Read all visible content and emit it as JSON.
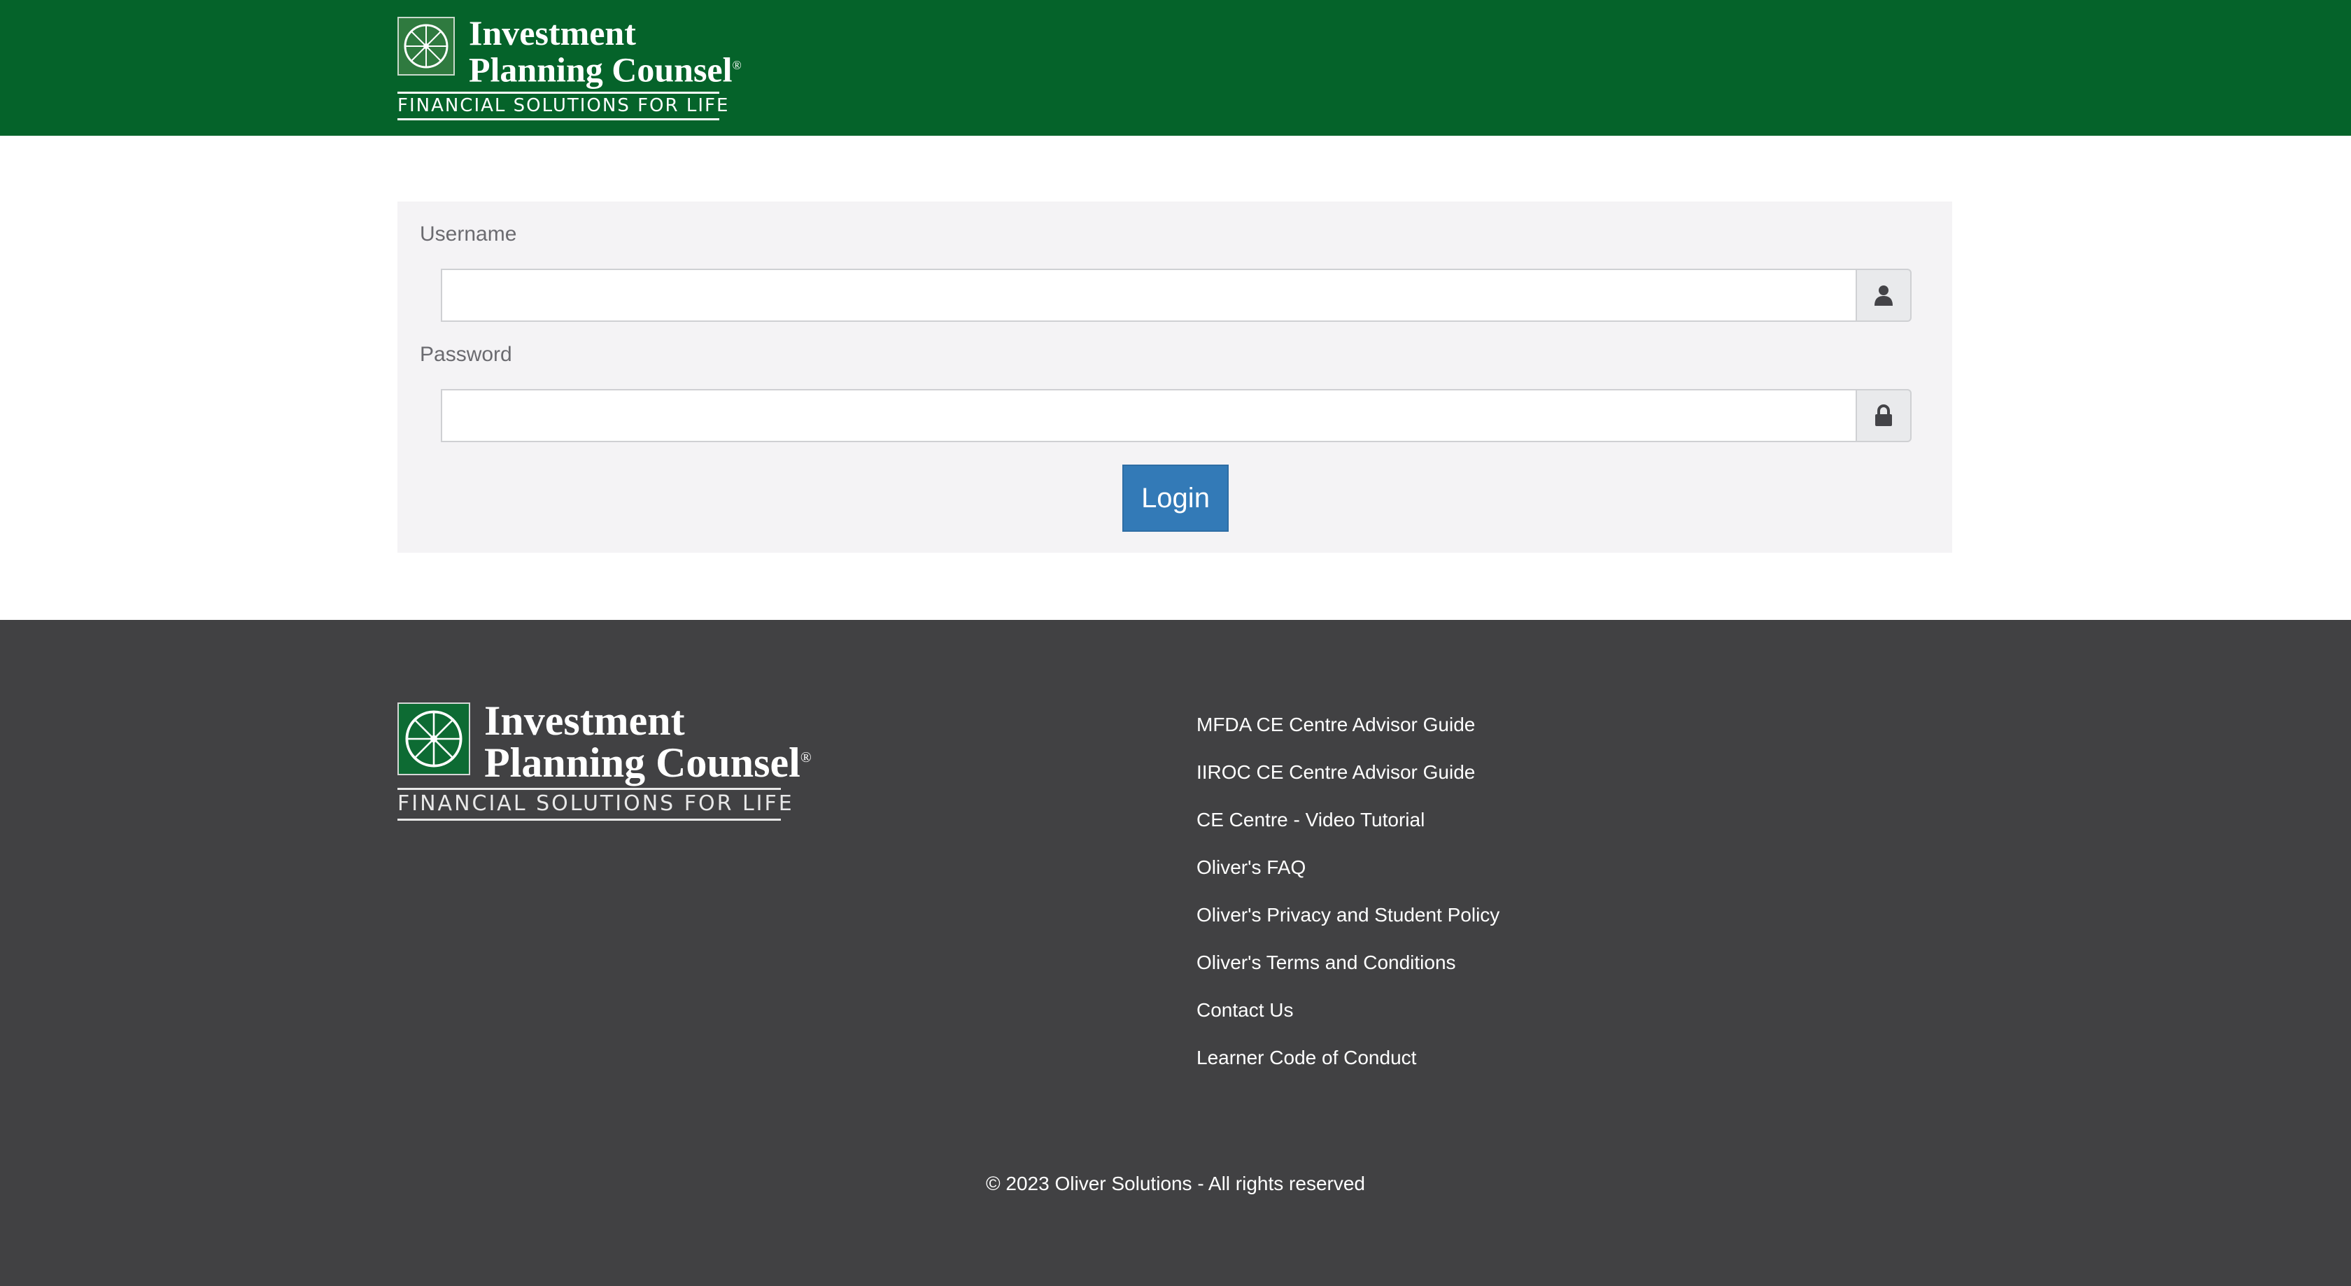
{
  "header": {
    "brand_line1": "Investment",
    "brand_line2": "Planning Counsel",
    "brand_reg": "®",
    "tagline": "FINANCIAL SOLUTIONS FOR LIFE",
    "logo_icon": "compass-wheel-logo-icon",
    "background_color": "#05632a"
  },
  "login": {
    "username_label": "Username",
    "username_value": "",
    "username_placeholder": "",
    "username_icon": "user-icon",
    "password_label": "Password",
    "password_value": "",
    "password_placeholder": "",
    "password_icon": "lock-icon",
    "login_button_label": "Login",
    "button_color": "#337ab7"
  },
  "footer": {
    "brand_line1": "Investment",
    "brand_line2": "Planning Counsel",
    "brand_reg": "®",
    "tagline": "FINANCIAL SOLUTIONS FOR LIFE",
    "links": [
      "MFDA CE Centre Advisor Guide",
      "IIROC CE Centre Advisor Guide",
      "CE Centre - Video Tutorial",
      "Oliver's FAQ",
      "Oliver's Privacy and Student Policy",
      "Oliver's Terms and Conditions",
      "Contact Us",
      "Learner Code of Conduct"
    ],
    "copyright": "© 2023 Oliver Solutions - All rights reserved",
    "background_color": "#414143"
  }
}
